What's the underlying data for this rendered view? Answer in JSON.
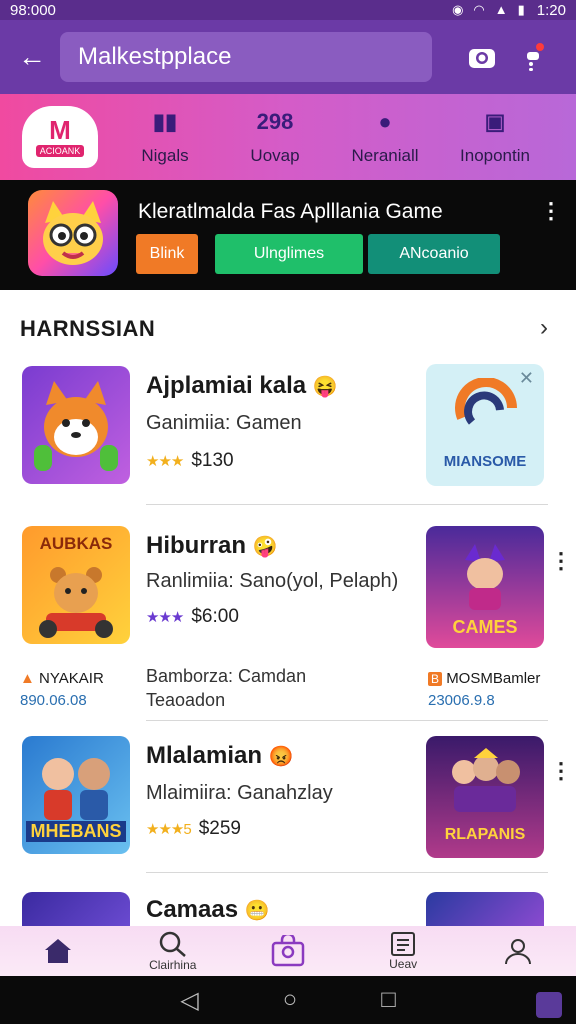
{
  "status": {
    "time_left": "98:000",
    "time_right": "1:20"
  },
  "app_bar": {
    "search_value": "Malkestpplace"
  },
  "categories": {
    "logo_text": "M",
    "logo_sub": "ACIOANK",
    "items": [
      {
        "icon": "nigals-icon",
        "glyph": "▮▮",
        "label": "Nigals"
      },
      {
        "icon": "number-icon",
        "glyph": "298",
        "label": "Uovap"
      },
      {
        "icon": "pin-icon",
        "glyph": "●",
        "label": "Neraniall"
      },
      {
        "icon": "briefcase-icon",
        "glyph": "▣",
        "label": "Inopontin"
      }
    ]
  },
  "promo": {
    "title": "Kleratlmalda Fas Aplllania Game",
    "btn_1": "Blink",
    "btn_2": "Ulnglimes",
    "btn_3": "ANcoanio"
  },
  "section": {
    "title": "HARNSSIAN"
  },
  "apps": [
    {
      "name": "Ajplamiai kala",
      "emoji": "😝",
      "sub": "Ganimiia: Gamen",
      "stars": "★★★",
      "price": "$130"
    },
    {
      "name": "Hiburran",
      "emoji": "🤪",
      "sub": "Ranlimiia: Sano(yol, Pelaph)",
      "stars": "★★★",
      "price": "$6:00"
    },
    {
      "name": "Mlalamian",
      "emoji": "😡",
      "sub": "Mlaimiira: Ganahzlay",
      "stars": "★★★5",
      "price": "$259"
    },
    {
      "name": "Camaas",
      "emoji": "😬"
    }
  ],
  "ad_card": {
    "text": "MIANSOME"
  },
  "side_cards": [
    {
      "text": "CAMES"
    },
    {
      "text": "RLAPANIS"
    }
  ],
  "extra_row": {
    "left_label": "NYAKAIR",
    "left_price": "890.06.08",
    "center_label": "Bamborza: Camdan",
    "center_sub": "Teaoadon",
    "right_label": "MOSMBamler",
    "right_price": "23006.9.8"
  },
  "thumb_titles": [
    "",
    "AUBKAS",
    "MHEBANS",
    ""
  ],
  "bottom_nav": [
    {
      "icon": "home-icon",
      "glyph": "⌂",
      "label": ""
    },
    {
      "icon": "search-icon",
      "glyph": "⌕",
      "label": "Clairhina"
    },
    {
      "icon": "bag-icon",
      "glyph": "▢",
      "label": ""
    },
    {
      "icon": "list-icon",
      "glyph": "☰",
      "label": "Ueav"
    },
    {
      "icon": "profile-icon",
      "glyph": "☺",
      "label": ""
    }
  ],
  "colors": {
    "purple": "#6b3aa6",
    "pink": "#f04aa0",
    "green": "#1fbf6a",
    "orange": "#f07a26"
  }
}
